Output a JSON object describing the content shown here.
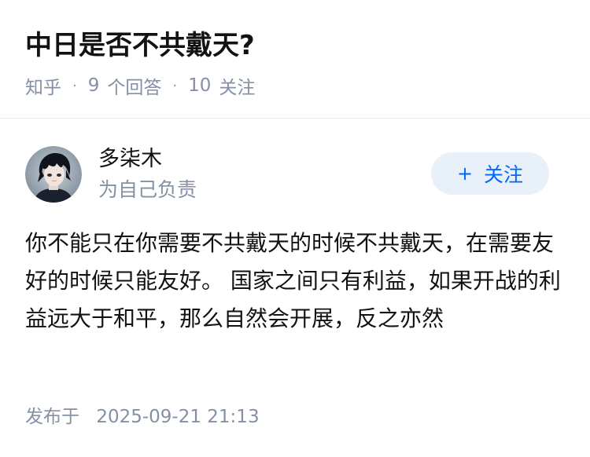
{
  "question": {
    "title": "中日是否不共戴天?",
    "source": "知乎",
    "answer_count": "9",
    "answer_label": "个回答",
    "follower_count": "10",
    "follower_label": "关注",
    "separator": "·"
  },
  "author": {
    "name": "多柒木",
    "headline": "为自己负责",
    "avatar": "anime-boy-avatar"
  },
  "follow_button": {
    "icon": "plus-icon",
    "symbol": "+",
    "label": "关注",
    "color": "#0066ff",
    "background": "#e8f0fa"
  },
  "answer": {
    "content": "你不能只在你需要不共戴天的时候不共戴天，在需要友好的时候只能友好。 国家之间只有利益，如果开战的利益远大于和平，那么自然会开展，反之亦然",
    "published_label": "发布于",
    "published_time": "2025-09-21 21:13"
  }
}
